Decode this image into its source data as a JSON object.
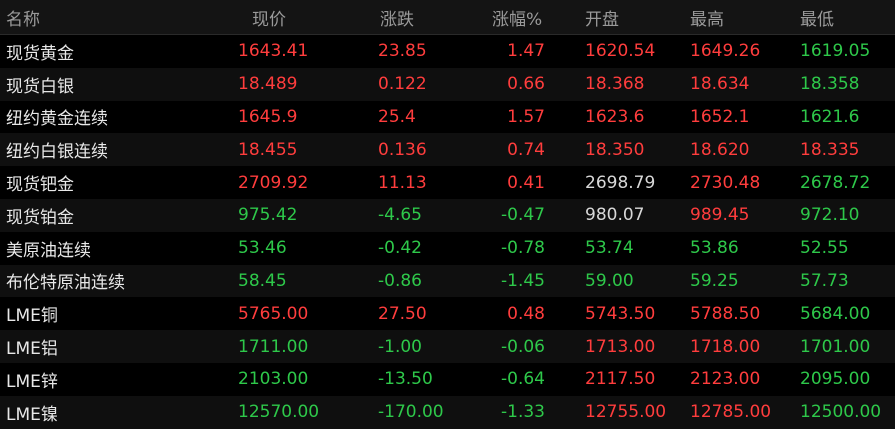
{
  "colors": {
    "up": "#ff3d3d",
    "down": "#2ec84a",
    "flat": "#d8d8d8"
  },
  "headers": {
    "name": "名称",
    "price": "现价",
    "change": "涨跌",
    "pct": "涨幅%",
    "open": "开盘",
    "high": "最高",
    "low": "最低"
  },
  "rows": [
    {
      "name": "现货黄金",
      "price": "1643.41",
      "change": "23.85",
      "pct": "1.47",
      "open": "1620.54",
      "high": "1649.26",
      "low": "1619.05",
      "dir": "up",
      "open_dir": "up",
      "high_dir": "up",
      "low_dir": "down"
    },
    {
      "name": "现货白银",
      "price": "18.489",
      "change": "0.122",
      "pct": "0.66",
      "open": "18.368",
      "high": "18.634",
      "low": "18.358",
      "dir": "up",
      "open_dir": "up",
      "high_dir": "up",
      "low_dir": "down"
    },
    {
      "name": "纽约黄金连续",
      "price": "1645.9",
      "change": "25.4",
      "pct": "1.57",
      "open": "1623.6",
      "high": "1652.1",
      "low": "1621.6",
      "dir": "up",
      "open_dir": "up",
      "high_dir": "up",
      "low_dir": "down"
    },
    {
      "name": "纽约白银连续",
      "price": "18.455",
      "change": "0.136",
      "pct": "0.74",
      "open": "18.350",
      "high": "18.620",
      "low": "18.335",
      "dir": "up",
      "open_dir": "up",
      "high_dir": "up",
      "low_dir": "up"
    },
    {
      "name": "现货钯金",
      "price": "2709.92",
      "change": "11.13",
      "pct": "0.41",
      "open": "2698.79",
      "high": "2730.48",
      "low": "2678.72",
      "dir": "up",
      "open_dir": "flat",
      "high_dir": "up",
      "low_dir": "down"
    },
    {
      "name": "现货铂金",
      "price": "975.42",
      "change": "-4.65",
      "pct": "-0.47",
      "open": "980.07",
      "high": "989.45",
      "low": "972.10",
      "dir": "down",
      "open_dir": "flat",
      "high_dir": "up",
      "low_dir": "down"
    },
    {
      "name": "美原油连续",
      "price": "53.46",
      "change": "-0.42",
      "pct": "-0.78",
      "open": "53.74",
      "high": "53.86",
      "low": "52.55",
      "dir": "down",
      "open_dir": "down",
      "high_dir": "down",
      "low_dir": "down"
    },
    {
      "name": "布伦特原油连续",
      "price": "58.45",
      "change": "-0.86",
      "pct": "-1.45",
      "open": "59.00",
      "high": "59.25",
      "low": "57.73",
      "dir": "down",
      "open_dir": "down",
      "high_dir": "down",
      "low_dir": "down"
    },
    {
      "name": "LME铜",
      "price": "5765.00",
      "change": "27.50",
      "pct": "0.48",
      "open": "5743.50",
      "high": "5788.50",
      "low": "5684.00",
      "dir": "up",
      "open_dir": "up",
      "high_dir": "up",
      "low_dir": "down"
    },
    {
      "name": "LME铝",
      "price": "1711.00",
      "change": "-1.00",
      "pct": "-0.06",
      "open": "1713.00",
      "high": "1718.00",
      "low": "1701.00",
      "dir": "down",
      "open_dir": "up",
      "high_dir": "up",
      "low_dir": "down"
    },
    {
      "name": "LME锌",
      "price": "2103.00",
      "change": "-13.50",
      "pct": "-0.64",
      "open": "2117.50",
      "high": "2123.00",
      "low": "2095.00",
      "dir": "down",
      "open_dir": "up",
      "high_dir": "up",
      "low_dir": "down"
    },
    {
      "name": "LME镍",
      "price": "12570.00",
      "change": "-170.00",
      "pct": "-1.33",
      "open": "12755.00",
      "high": "12785.00",
      "low": "12500.00",
      "dir": "down",
      "open_dir": "up",
      "high_dir": "up",
      "low_dir": "down"
    }
  ]
}
